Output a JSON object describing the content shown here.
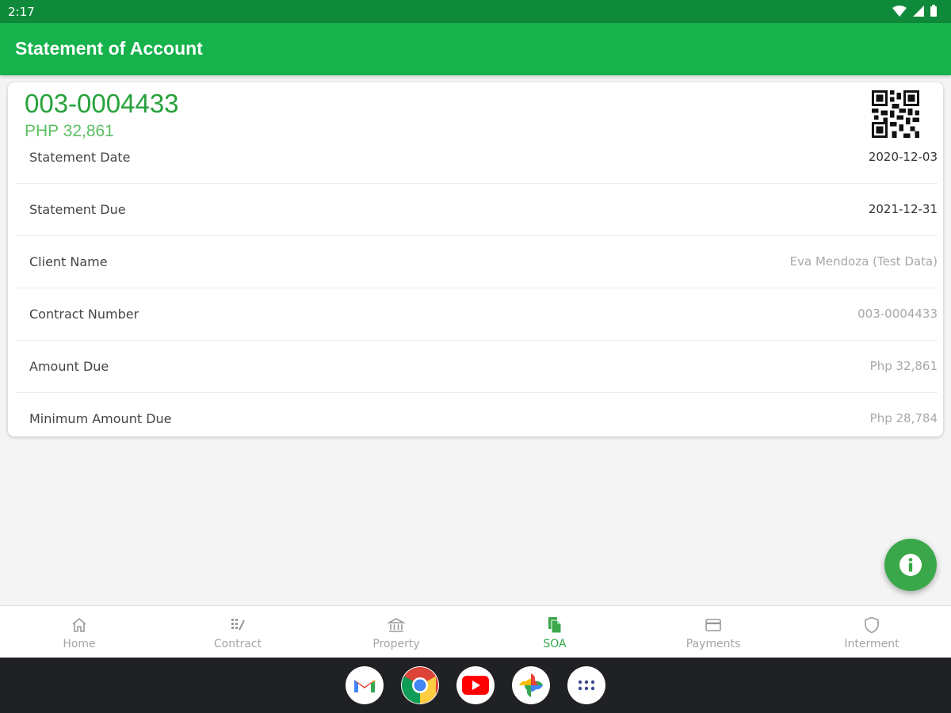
{
  "status_bar": {
    "time": "2:17"
  },
  "app_bar": {
    "title": "Statement of Account"
  },
  "account": {
    "contract_number": "003-0004433",
    "amount": "PHP 32,861"
  },
  "details": [
    {
      "label": "Statement Date",
      "value": "2020-12-03"
    },
    {
      "label": "Statement Due",
      "value": "2021-12-31"
    },
    {
      "label": "Client Name",
      "value": "Eva Mendoza (Test Data)"
    },
    {
      "label": "Contract Number",
      "value": "003-0004433"
    },
    {
      "label": "Amount Due",
      "value": "Php 32,861"
    },
    {
      "label": "Minimum Amount Due",
      "value": "Php 28,784"
    }
  ],
  "fab": {
    "icon": "info-icon"
  },
  "bottom_nav": [
    {
      "label": "Home",
      "icon": "home-icon"
    },
    {
      "label": "Contract",
      "icon": "contract-icon"
    },
    {
      "label": "Property",
      "icon": "bank-icon"
    },
    {
      "label": "SOA",
      "icon": "document-icon",
      "active": true
    },
    {
      "label": "Payments",
      "icon": "credit-card-icon"
    },
    {
      "label": "Interment",
      "icon": "shield-icon"
    }
  ],
  "dock": [
    "gmail-icon",
    "chrome-icon",
    "youtube-icon",
    "photos-icon",
    "app-drawer-icon"
  ],
  "colors": {
    "app_bar": "#16b24c",
    "status_bar": "#0f8a3a",
    "accent": "#27a23b",
    "fab": "#3aa84a"
  }
}
